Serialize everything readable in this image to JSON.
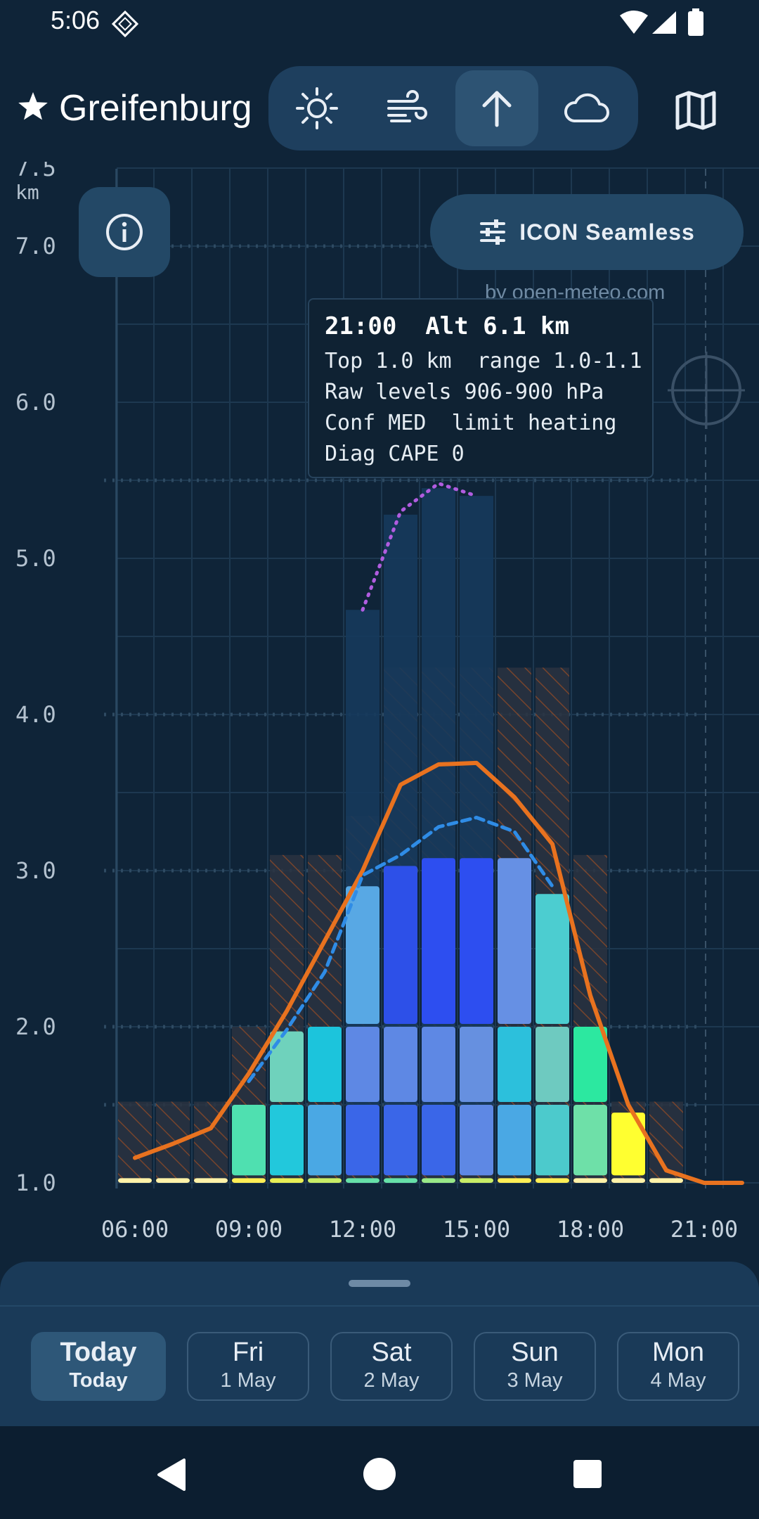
{
  "status_bar": {
    "time": "5:06"
  },
  "header": {
    "location": "Greifenburg"
  },
  "modes": [
    {
      "name": "sun-mode",
      "icon": "sun-icon",
      "active": false
    },
    {
      "name": "wind-mode",
      "icon": "wind-icon",
      "active": false
    },
    {
      "name": "thermal-mode",
      "icon": "arrow-up-icon",
      "active": true
    },
    {
      "name": "cloud-mode",
      "icon": "cloud-icon",
      "active": false
    }
  ],
  "model": {
    "label": "ICON Seamless"
  },
  "attribution": "by open-meteo.com",
  "tooltip": {
    "title": "21:00  Alt 6.1 km",
    "lines": [
      "Top 1.0 km  range 1.0-1.1",
      "Raw levels 906-900 hPa",
      "Conf MED  limit heating",
      "Diag CAPE 0"
    ]
  },
  "chart_data": {
    "type": "bar",
    "y_unit": "km",
    "ylim": [
      1.0,
      7.5
    ],
    "y_ticks": [
      "7.5",
      "7.0",
      "6.0",
      "5.0",
      "4.0",
      "3.0",
      "2.0",
      "1.0"
    ],
    "x_ticks": [
      "06:00",
      "09:00",
      "12:00",
      "15:00",
      "18:00",
      "21:00"
    ],
    "hours": [
      6,
      7,
      8,
      9,
      10,
      11,
      12,
      13,
      14,
      15,
      16,
      17,
      18,
      19,
      20,
      21,
      22
    ],
    "columns": [
      {
        "h": 6,
        "segments": [
          {
            "top": 1.03,
            "color": "#fff2a8"
          }
        ],
        "hatch_top": 1.52
      },
      {
        "h": 7,
        "segments": [
          {
            "top": 1.03,
            "color": "#fff2a8"
          }
        ],
        "hatch_top": 1.52
      },
      {
        "h": 8,
        "segments": [
          {
            "top": 1.03,
            "color": "#fff2a8"
          }
        ],
        "hatch_top": 1.52
      },
      {
        "h": 9,
        "segments": [
          {
            "top": 1.03,
            "color": "#ffee55"
          },
          {
            "top": 1.5,
            "color": "#4fe0b0"
          }
        ],
        "hatch_top": 2.0
      },
      {
        "h": 10,
        "segments": [
          {
            "top": 1.03,
            "color": "#e8ee55"
          },
          {
            "top": 1.5,
            "color": "#22c8dc"
          },
          {
            "top": 1.97,
            "color": "#6fd2bc"
          }
        ],
        "hatch_top": 3.1
      },
      {
        "h": 11,
        "segments": [
          {
            "top": 1.03,
            "color": "#c8ec66"
          },
          {
            "top": 1.5,
            "color": "#4aa8e4"
          },
          {
            "top": 2.0,
            "color": "#1cc4dc"
          }
        ],
        "hatch_top": 3.1
      },
      {
        "h": 12,
        "segments": [
          {
            "top": 1.03,
            "color": "#66e0a8"
          },
          {
            "top": 1.5,
            "color": "#3a66e8"
          },
          {
            "top": 2.0,
            "color": "#5e88e4"
          },
          {
            "top": 2.9,
            "color": "#58a8e4"
          }
        ],
        "hatch_top": 3.35,
        "cloud_top": 4.67
      },
      {
        "h": 13,
        "segments": [
          {
            "top": 1.03,
            "color": "#66e0a8"
          },
          {
            "top": 1.5,
            "color": "#3a66e8"
          },
          {
            "top": 2.0,
            "color": "#5e88e4"
          },
          {
            "top": 3.03,
            "color": "#2d50e8"
          }
        ],
        "hatch_top": 4.3,
        "cloud_top": 5.28
      },
      {
        "h": 14,
        "segments": [
          {
            "top": 1.03,
            "color": "#99e888"
          },
          {
            "top": 1.5,
            "color": "#3a66e8"
          },
          {
            "top": 2.0,
            "color": "#5e88e4"
          },
          {
            "top": 3.08,
            "color": "#2d4ef0"
          }
        ],
        "hatch_top": 4.3,
        "cloud_top": 5.45
      },
      {
        "h": 15,
        "segments": [
          {
            "top": 1.03,
            "color": "#c8ec66"
          },
          {
            "top": 1.5,
            "color": "#5e88e4"
          },
          {
            "top": 2.0,
            "color": "#6690e0"
          },
          {
            "top": 3.08,
            "color": "#2d4ef0"
          }
        ],
        "hatch_top": 4.3,
        "cloud_top": 5.4
      },
      {
        "h": 16,
        "segments": [
          {
            "top": 1.03,
            "color": "#ffee55"
          },
          {
            "top": 1.5,
            "color": "#4aa8e4"
          },
          {
            "top": 2.0,
            "color": "#2cc0dc"
          },
          {
            "top": 3.08,
            "color": "#6690e4"
          }
        ],
        "hatch_top": 4.3
      },
      {
        "h": 17,
        "segments": [
          {
            "top": 1.03,
            "color": "#ffee55"
          },
          {
            "top": 1.5,
            "color": "#4ccacc"
          },
          {
            "top": 2.0,
            "color": "#6ecac0"
          },
          {
            "top": 2.85,
            "color": "#4ccdd0"
          }
        ],
        "hatch_top": 4.3
      },
      {
        "h": 18,
        "segments": [
          {
            "top": 1.03,
            "color": "#fff2a8"
          },
          {
            "top": 1.5,
            "color": "#6ee0a8"
          },
          {
            "top": 2.0,
            "color": "#2ce8a0"
          }
        ],
        "hatch_top": 3.1
      },
      {
        "h": 19,
        "segments": [
          {
            "top": 1.03,
            "color": "#fff2a8"
          },
          {
            "top": 1.45,
            "color": "#ffff30"
          }
        ],
        "hatch_top": 1.52
      },
      {
        "h": 20,
        "segments": [
          {
            "top": 1.03,
            "color": "#fff2a8"
          }
        ],
        "hatch_top": 1.52
      }
    ],
    "series": [
      {
        "style": "solid-orange",
        "color": "#e8721f",
        "points": [
          [
            6,
            1.16
          ],
          [
            7,
            1.25
          ],
          [
            8,
            1.35
          ],
          [
            9,
            1.7
          ],
          [
            10,
            2.1
          ],
          [
            11,
            2.55
          ],
          [
            12,
            3.0
          ],
          [
            13,
            3.55
          ],
          [
            14,
            3.68
          ],
          [
            15,
            3.69
          ],
          [
            16,
            3.47
          ],
          [
            17,
            3.17
          ],
          [
            18,
            2.2
          ],
          [
            19,
            1.5
          ],
          [
            20,
            1.08
          ],
          [
            21,
            1.0
          ],
          [
            22,
            1.0
          ]
        ]
      },
      {
        "style": "dashed-blue",
        "color": "#2f8ce6",
        "points": [
          [
            9,
            1.65
          ],
          [
            10,
            1.98
          ],
          [
            11,
            2.35
          ],
          [
            12,
            2.97
          ],
          [
            13,
            3.1
          ],
          [
            14,
            3.28
          ],
          [
            15,
            3.34
          ],
          [
            16,
            3.25
          ],
          [
            17,
            2.9
          ]
        ]
      },
      {
        "style": "dotted-purple",
        "color": "#b15ce0",
        "points": [
          [
            12,
            4.67
          ],
          [
            13,
            5.3
          ],
          [
            14,
            5.48
          ],
          [
            15,
            5.4
          ]
        ]
      }
    ]
  }
}
